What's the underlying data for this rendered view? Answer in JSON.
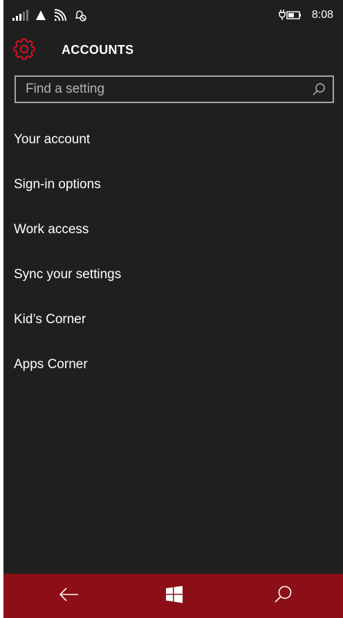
{
  "status_bar": {
    "time": "8:08",
    "icons": [
      "signal-icon",
      "data-icon",
      "wifi-icon",
      "quiet-hours-icon",
      "battery-charging-icon"
    ]
  },
  "header": {
    "title": "ACCOUNTS",
    "icon": "gear-icon"
  },
  "search": {
    "placeholder": "Find a setting",
    "value": "",
    "icon": "search-icon"
  },
  "menu": {
    "items": [
      {
        "label": "Your account"
      },
      {
        "label": "Sign-in options"
      },
      {
        "label": "Work access"
      },
      {
        "label": "Sync your settings"
      },
      {
        "label": "Kid’s Corner"
      },
      {
        "label": "Apps Corner"
      }
    ]
  },
  "nav_bar": {
    "buttons": [
      "back-icon",
      "windows-start-icon",
      "search-icon"
    ]
  },
  "colors": {
    "background": "#1f1f1f",
    "accent": "#e81123",
    "nav_bar": "#8c0f17",
    "text": "#ffffff",
    "search_border": "#a6a6a6"
  }
}
